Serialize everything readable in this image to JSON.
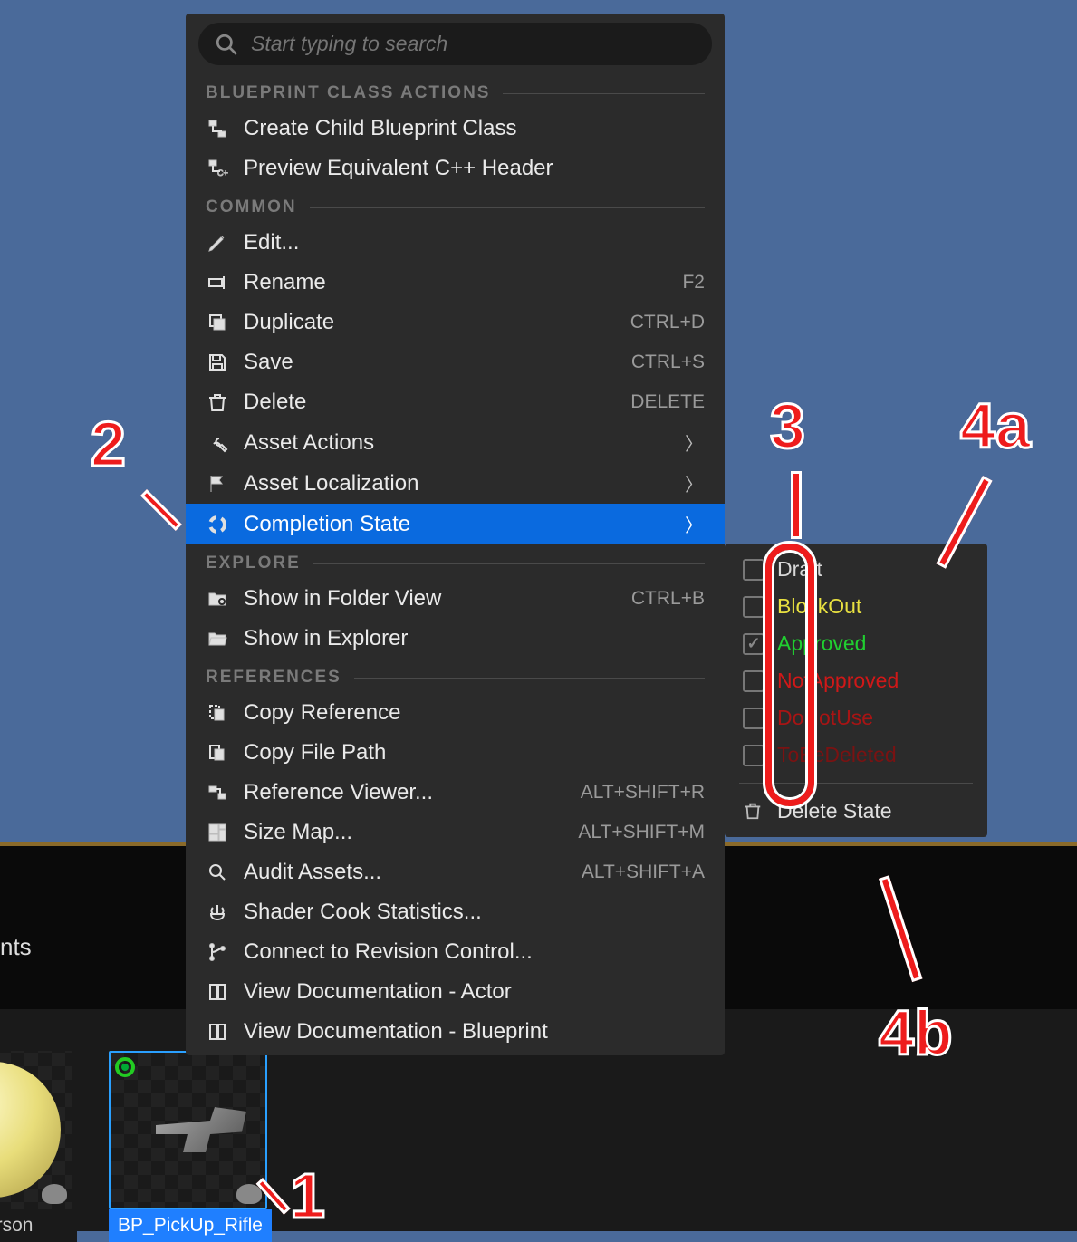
{
  "background": {
    "viewport_color": "#4a6a9a",
    "panel_label": "nts"
  },
  "assets": [
    {
      "name": "stPerson",
      "selected": false,
      "kind": "sphere"
    },
    {
      "name": "BP_PickUp_Rifle",
      "selected": true,
      "kind": "gun"
    }
  ],
  "search": {
    "placeholder": "Start typing to search"
  },
  "menu": {
    "sections": [
      {
        "title": "BLUEPRINT CLASS ACTIONS",
        "items": [
          {
            "icon": "bp-child",
            "label": "Create Child Blueprint Class"
          },
          {
            "icon": "cpp-header",
            "label": "Preview Equivalent C++ Header"
          }
        ]
      },
      {
        "title": "COMMON",
        "items": [
          {
            "icon": "pencil",
            "label": "Edit..."
          },
          {
            "icon": "rename",
            "label": "Rename",
            "shortcut": "F2"
          },
          {
            "icon": "duplicate",
            "label": "Duplicate",
            "shortcut": "CTRL+D"
          },
          {
            "icon": "save",
            "label": "Save",
            "shortcut": "CTRL+S"
          },
          {
            "icon": "trash",
            "label": "Delete",
            "shortcut": "DELETE"
          },
          {
            "icon": "wrench",
            "label": "Asset Actions",
            "submenu": true
          },
          {
            "icon": "flag",
            "label": "Asset Localization",
            "submenu": true
          },
          {
            "icon": "ring",
            "label": "Completion State",
            "submenu": true,
            "selected": true
          }
        ]
      },
      {
        "title": "EXPLORE",
        "items": [
          {
            "icon": "folder-view",
            "label": "Show in Folder View",
            "shortcut": "CTRL+B"
          },
          {
            "icon": "folder-open",
            "label": "Show in Explorer"
          }
        ]
      },
      {
        "title": "REFERENCES",
        "items": [
          {
            "icon": "copy-ref",
            "label": "Copy Reference"
          },
          {
            "icon": "copy-path",
            "label": "Copy File Path"
          },
          {
            "icon": "ref-viewer",
            "label": "Reference Viewer...",
            "shortcut": "ALT+SHIFT+R"
          },
          {
            "icon": "size-map",
            "label": "Size Map...",
            "shortcut": "ALT+SHIFT+M"
          },
          {
            "icon": "audit",
            "label": "Audit Assets...",
            "shortcut": "ALT+SHIFT+A"
          },
          {
            "icon": "shader",
            "label": "Shader Cook Statistics..."
          },
          {
            "icon": "branch",
            "label": "Connect to Revision Control..."
          },
          {
            "icon": "book",
            "label": "View Documentation - Actor"
          },
          {
            "icon": "book",
            "label": "View Documentation - Blueprint"
          }
        ]
      }
    ]
  },
  "completion_submenu": {
    "states": [
      {
        "label": "Draft",
        "color": "#d8d8d8",
        "checked": false
      },
      {
        "label": "BlockOut",
        "color": "#e8e040",
        "checked": false
      },
      {
        "label": "Approved",
        "color": "#20d030",
        "checked": true
      },
      {
        "label": "NotApproved",
        "color": "#d01818",
        "checked": false
      },
      {
        "label": "DoNotUse",
        "color": "#a81414",
        "checked": false
      },
      {
        "label": "ToBeDeleted",
        "color": "#7a1212",
        "checked": false
      }
    ],
    "delete_label": "Delete State"
  },
  "annotations": {
    "n1": "1",
    "n2": "2",
    "n3": "3",
    "n4a": "4a",
    "n4b": "4b"
  },
  "colors": {
    "accent": "#0a6adf",
    "annotation": "#ee1c1c"
  }
}
